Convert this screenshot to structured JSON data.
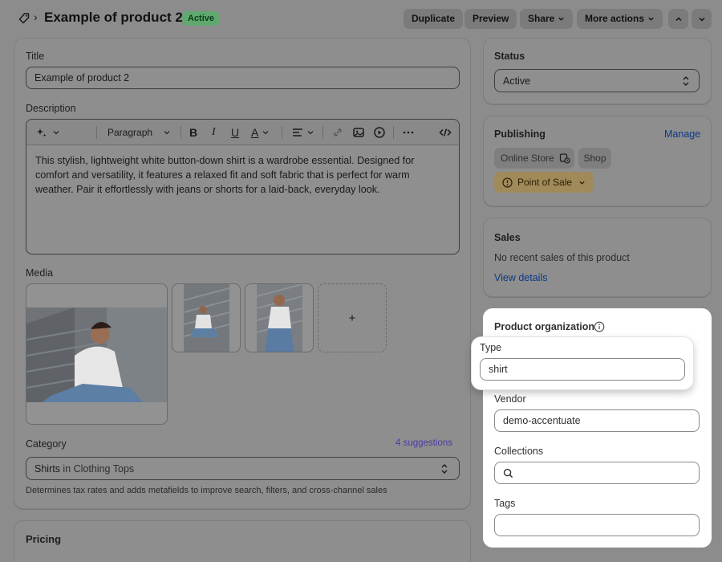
{
  "header": {
    "title": "Example of product 2",
    "status": "Active",
    "buttons": {
      "duplicate": "Duplicate",
      "preview": "Preview",
      "share": "Share",
      "more_actions": "More actions"
    }
  },
  "main": {
    "title_label": "Title",
    "title_value": "Example of product 2",
    "description_label": "Description",
    "toolbar": {
      "paragraph": "Paragraph"
    },
    "description_text": "This stylish, lightweight white button-down shirt is a wardrobe essential. Designed for comfort and versatility, it features a relaxed fit and soft fabric that is perfect for warm weather. Pair it effortlessly with jeans or shorts for a laid-back, everyday look.",
    "media_label": "Media",
    "add_media": "+",
    "category_label": "Category",
    "category_suggestions": "4 suggestions",
    "category_value_main": "Shirts",
    "category_value_rest": " in Clothing Tops",
    "category_help": "Determines tax rates and adds metafields to improve search, filters, and cross-channel sales",
    "pricing_label": "Pricing"
  },
  "side": {
    "status": {
      "label": "Status",
      "value": "Active"
    },
    "publishing": {
      "label": "Publishing",
      "manage": "Manage",
      "channels": [
        "Online Store",
        "Shop",
        "Point of Sale"
      ]
    },
    "sales": {
      "label": "Sales",
      "text": "No recent sales of this product",
      "link": "View details"
    },
    "organization": {
      "label": "Product organization",
      "type_label": "Type",
      "type_value": "shirt",
      "vendor_label": "Vendor",
      "vendor_value": "demo-accentuate",
      "collections_label": "Collections",
      "tags_label": "Tags"
    }
  },
  "colors": {
    "active_badge": "#5fa86f",
    "link": "#0a3a86",
    "suggestions": "#4a3aa8",
    "point_of_sale_badge": "#a08a5a"
  }
}
